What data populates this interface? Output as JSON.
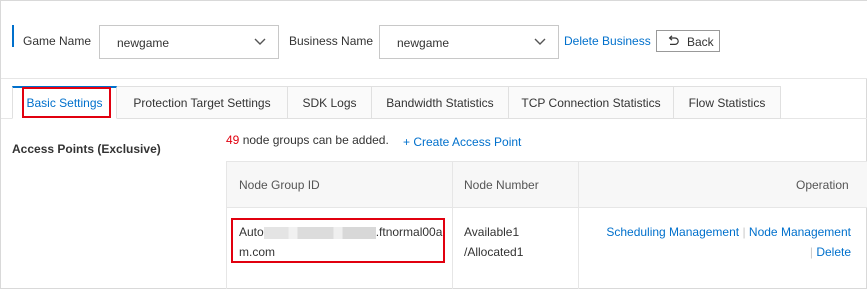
{
  "filters": {
    "game_label": "Game Name",
    "game_value": "newgame",
    "business_label": "Business Name",
    "business_value": "newgame",
    "delete_business": "Delete Business",
    "back_label": "Back"
  },
  "tabs": [
    {
      "label": "Basic Settings",
      "active": true
    },
    {
      "label": "Protection Target Settings",
      "active": false
    },
    {
      "label": "SDK Logs",
      "active": false
    },
    {
      "label": "Bandwidth Statistics",
      "active": false
    },
    {
      "label": "TCP Connection Statistics",
      "active": false
    },
    {
      "label": "Flow Statistics",
      "active": false
    }
  ],
  "section": {
    "title": "Access Points (Exclusive)",
    "count": "49",
    "count_suffix": " node groups can be added.",
    "create_label": "+ Create Access Point"
  },
  "table": {
    "headers": {
      "node_group_id": "Node Group ID",
      "node_number": "Node Number",
      "operation": "Operation"
    },
    "rows": [
      {
        "id_prefix": "Auto",
        "id_suffix": ".ftnormal00a",
        "id_line2": "m.com",
        "available": "Available1",
        "allocated": "/Allocated1",
        "op_scheduling": "Scheduling Management",
        "op_separator": "|",
        "op_node": "Node Management",
        "op_delete": "Delete"
      }
    ]
  },
  "colors": {
    "accent": "#0070cc",
    "highlight": "#e1000f",
    "count": "#e1000f"
  }
}
